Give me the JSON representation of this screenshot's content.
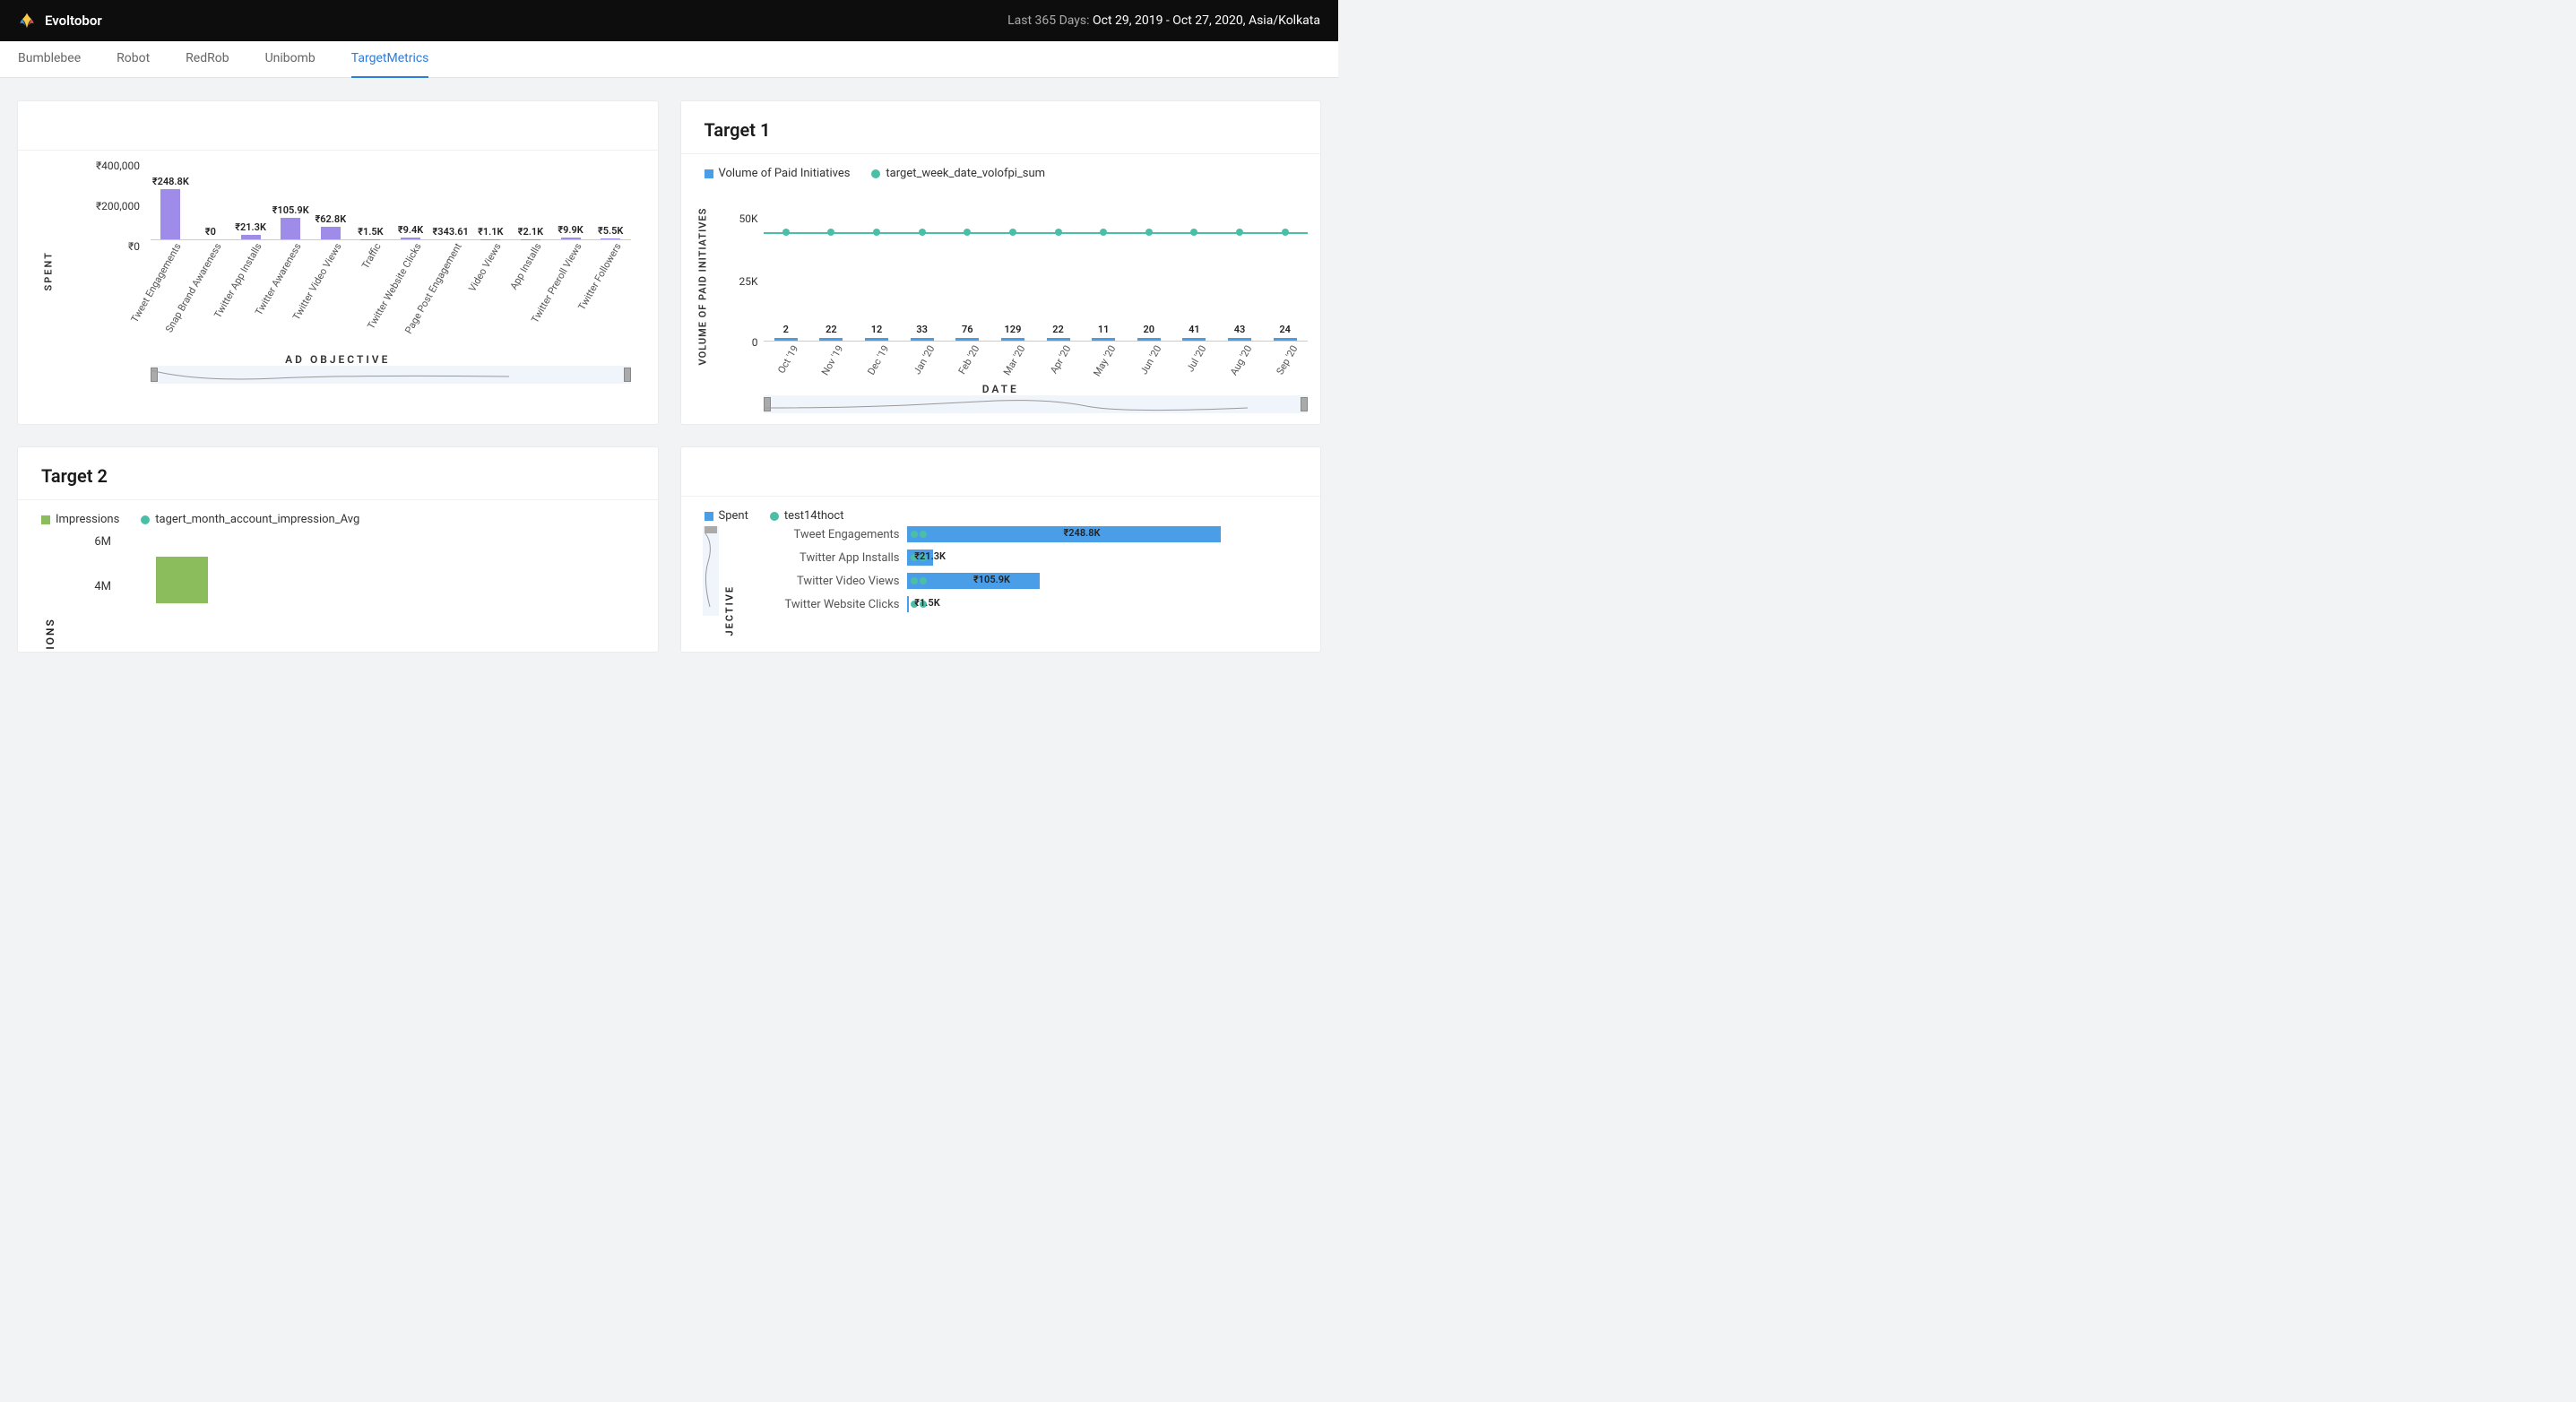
{
  "header": {
    "brand": "Evoltobor",
    "range_prefix": "Last 365 Days: ",
    "range_value": "Oct 29, 2019 - Oct 27, 2020, Asia/Kolkata"
  },
  "tabs": [
    "Bumblebee",
    "Robot",
    "RedRob",
    "Unibomb",
    "TargetMetrics"
  ],
  "active_tab": 4,
  "card1": {
    "title": "",
    "ylabel": "SPENT",
    "xlabel": "AD OBJECTIVE",
    "yticks": [
      "₹400,000",
      "₹200,000",
      "₹0"
    ]
  },
  "card2": {
    "title": "Target 1",
    "legend_a": "Volume of Paid Initiatives",
    "legend_b": "target_week_date_volofpi_sum",
    "ylabel": "VOLUME OF PAID INITIATIVES",
    "xlabel": "DATE",
    "yticks": [
      "50K",
      "25K",
      "0"
    ]
  },
  "card3": {
    "title": "Target 2",
    "legend_a": "Impressions",
    "legend_b": "tagert_month_account_impression_Avg",
    "ylabel": "SIONS",
    "yticks": [
      "6M",
      "4M"
    ]
  },
  "card4": {
    "legend_a": "Spent",
    "legend_b": "test14thoct",
    "ylabel": "JECTIVE"
  },
  "colors": {
    "purple_bar": "#9f8be8",
    "blue_bar": "#4a9ee8",
    "teal_line": "#4bbfa6",
    "green_bar": "#8bbd5c"
  },
  "chart_data": [
    {
      "type": "bar",
      "title": "",
      "xlabel": "AD OBJECTIVE",
      "ylabel": "SPENT",
      "ylim": [
        0,
        400000
      ],
      "categories": [
        "Tweet Engagements",
        "Snap Brand Awareness",
        "Twitter App Installs",
        "Twitter Awareness",
        "Twitter Video Views",
        "Traffic",
        "Twitter Website Clicks",
        "Page Post Engagement",
        "Video Views",
        "App Installs",
        "Twitter Preroll Views",
        "Twitter Followers"
      ],
      "values_label": [
        "₹248.8K",
        "₹0",
        "₹21.3K",
        "₹105.9K",
        "₹62.8K",
        "₹1.5K",
        "₹9.4K",
        "₹343.61",
        "₹1.1K",
        "₹2.1K",
        "₹9.9K",
        "₹5.5K"
      ],
      "values": [
        248800,
        0,
        21300,
        105900,
        62800,
        1500,
        9400,
        343.61,
        1100,
        2100,
        9900,
        5500
      ]
    },
    {
      "type": "bar+line",
      "title": "Target 1",
      "xlabel": "DATE",
      "ylabel": "VOLUME OF PAID INITIATIVES",
      "ylim": [
        0,
        50000
      ],
      "categories": [
        "Oct '19",
        "Nov '19",
        "Dec '19",
        "Jan '20",
        "Feb '20",
        "Mar '20",
        "Apr '20",
        "May '20",
        "Jun '20",
        "Jul '20",
        "Aug '20",
        "Sep '20"
      ],
      "series": [
        {
          "name": "Volume of Paid Initiatives",
          "values": [
            2,
            22,
            12,
            33,
            76,
            129,
            22,
            11,
            20,
            41,
            43,
            24
          ]
        },
        {
          "name": "target_week_date_volofpi_sum",
          "values": [
            43000,
            43000,
            43000,
            43000,
            43000,
            43000,
            43000,
            43000,
            43000,
            43000,
            43000,
            43000
          ]
        }
      ]
    },
    {
      "type": "bar+line",
      "title": "Target 2",
      "xlabel": "",
      "ylabel": "IMPRESSIONS",
      "ylim": [
        0,
        6000000
      ],
      "series": [
        {
          "name": "Impressions",
          "values": [
            5000000
          ]
        },
        {
          "name": "tagert_month_account_impression_Avg",
          "values": []
        }
      ]
    },
    {
      "type": "bar",
      "orientation": "horizontal",
      "xlabel": "",
      "ylabel": "AD OBJECTIVE",
      "categories": [
        "Tweet Engagements",
        "Twitter App Installs",
        "Twitter Video Views",
        "Twitter Website Clicks"
      ],
      "series": [
        {
          "name": "Spent",
          "values_label": [
            "₹248.8K",
            "₹21.3K",
            "₹105.9K",
            "₹1.5K"
          ],
          "values": [
            248800,
            21300,
            105900,
            1500
          ]
        },
        {
          "name": "test14thoct",
          "values": []
        }
      ]
    }
  ]
}
